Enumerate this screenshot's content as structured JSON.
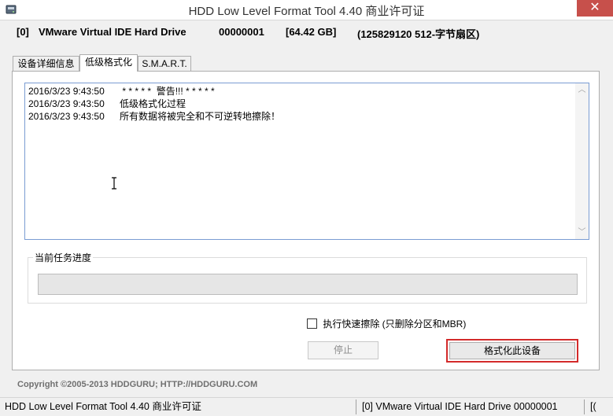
{
  "window": {
    "title": "HDD Low Level Format Tool 4.40     商业许可证",
    "close_glyph": "✕"
  },
  "drive": {
    "index": "[0]",
    "name": "VMware Virtual IDE Hard Drive",
    "serial": "00000001",
    "size": "[64.42 GB]",
    "sectors": "(125829120 512-字节扇区)"
  },
  "tabs": [
    {
      "label": "设备详细信息"
    },
    {
      "label": "低级格式化"
    },
    {
      "label": "S.M.A.R.T."
    }
  ],
  "log": [
    {
      "time": "2016/3/23 9:43:50",
      "message": " * * * * *  警告!!! * * * * *"
    },
    {
      "time": "2016/3/23 9:43:50",
      "message": "低级格式化过程"
    },
    {
      "time": "2016/3/23 9:43:50",
      "message": "所有数据将被完全和不可逆转地擦除！"
    }
  ],
  "progress": {
    "label": "当前任务进度",
    "value": 0
  },
  "options": {
    "quick_wipe_label": "执行快速擦除 (只删除分区和MBR)",
    "quick_wipe_checked": false
  },
  "buttons": {
    "stop": "停止",
    "format": "格式化此设备"
  },
  "footer": {
    "copyright": "Copyright ©2005-2013 HDDGURU;    HTTP://HDDGURU.COM"
  },
  "statusbar": {
    "app": "HDD Low Level Format Tool 4.40      商业许可证",
    "drive": "[0]  VMware Virtual IDE Hard Drive     00000001",
    "trailing": "[("
  },
  "colors": {
    "close_button": "#c7504b",
    "log_border": "#7a9cd3",
    "format_highlight": "#d32a2a"
  }
}
